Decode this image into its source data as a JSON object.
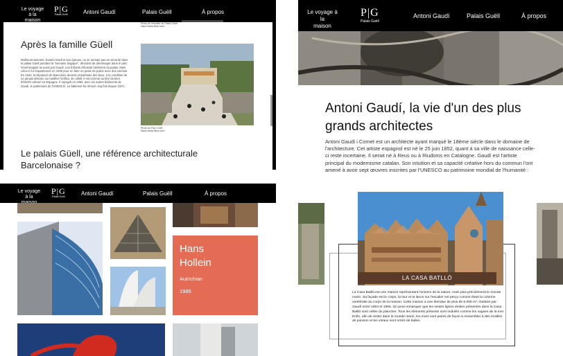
{
  "site": {
    "brand_line1": "Le voyage à la",
    "brand_line2": "maison",
    "logo_letters": "P|G",
    "logo_subtitle": "Palais Guëll",
    "nav": [
      "Antoni Gaudí",
      "Palais Guëll",
      "À propos"
    ]
  },
  "panel1": {
    "caption_top_1": "Photo de l'escalier du Palais Güell",
    "caption_top_2": "https://www.flickr.com/",
    "heading": "Après la famille Güell",
    "body": "Malheureusement, Eusebi Güell et son épouse, ne se sentant pas en sécurité dans le palais Güell pendant la \"semaine tragique\", décident de déménager dans le parc Güell imaginé lui aussi par Gaudí. Les Enfants d'Eusebi héritèrent du palais. Mais celui-ci fut réquisitionné en 1936 pour en faire un poste de police avec des cachots. En 1944, la Diputació de Barcelone devient propriétaire des lieux, à la condition de ne jamais détruire ou modifier l'édifice. En 1969, il est nommé au titre de bien d'intérêt culturel en Espagne. Il rejoignit en 1984, avec six autres bâtiments de Gaudí, le patrimoine de l'UNESCO. Le bâtiment fut rénové cinq fois depuis 1974.",
    "photo_caption_1": "Photo du Parc Güell",
    "photo_caption_2": "https://www.flickr.com/",
    "heading2": "Le palais Güell, une référence architecturale Barcelonaise ?"
  },
  "panel2": {
    "title": "Antoni Gaudí, la vie d'un des plus grands architectes",
    "body": "Antoni Gaudí i Cornet est un architecte ayant marqué le 18ème siècle dans le domaine de l'architecture. Cet artiste espagnol est né le 25 juin 1852, quant à sa ville de naissance celle-ci reste incertaine. Il serait né à Reus ou à Riudoms en Catalogne. Gaudí est l'artiste principal du modernisme catalan. Son intuition et sa capacité créative hors du commun l'ont amené à avoir sept œuvres inscrites par l'UNESCO au patrimoine mondial de l'humanité :",
    "card_label": "LA CASA BATLLÓ",
    "card_text": "La Casa Batlló est une maison représentant l'univers de la nature, mais plus précisément le monde marin. Sa façade est le corps, la tour et la lance sur l'escalier est perçu comme étant la colonne vertébrale du corps de la maison. Cette maison a une étendue de plus de 5 000 m², réalisée par Gaudí entre 1904 et 1906. On peut remarquer que les seules lignes droites présentes dans la Casa Batlló sont celles du plancher. Tous les éléments présents sont ondulés comme les vagues de la mer. Enfin, afin de rester dans le monde marin, les murs sont peints de façon à ressembler à des écailles de poisson et les vitraux sont ornés de bulles."
  },
  "panel3": {
    "architect_name": "Hans Hollein",
    "nationality": "Autrichian",
    "year": "1985"
  },
  "colors": {
    "nav_bg": "#000000",
    "hollein_card": "#e46c55",
    "card_border": "#c8a27a",
    "label_bg": "#5a3a28"
  }
}
